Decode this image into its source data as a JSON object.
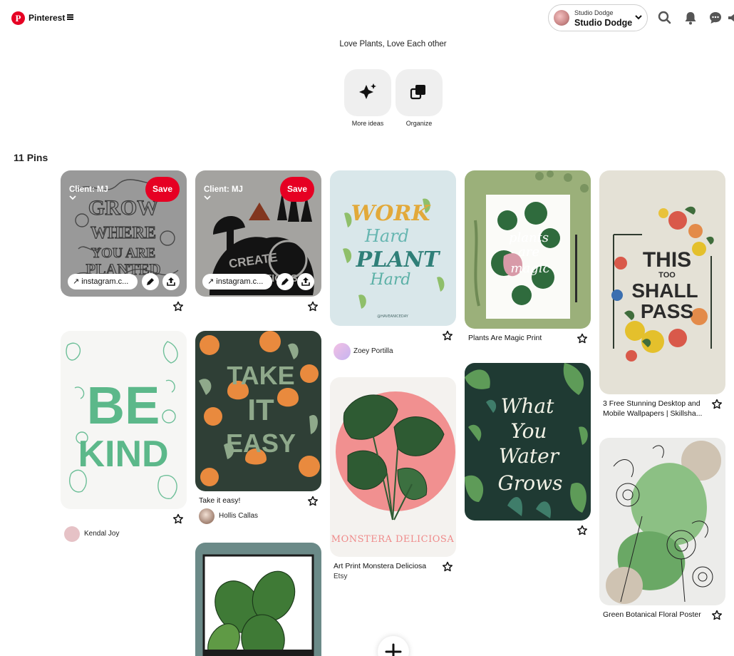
{
  "header": {
    "brand": "Pinterest",
    "account_small": "Studio Dodge",
    "account_name": "Studio Dodge"
  },
  "board": {
    "description": "Love Plants, Love Each other",
    "more_ideas_label": "More ideas",
    "organize_label": "Organize",
    "pin_count": "11 Pins"
  },
  "pins": {
    "grow": {
      "client": "Client: MJ",
      "save": "Save",
      "link": "instagram.c..."
    },
    "create": {
      "client": "Client: MJ",
      "save": "Save",
      "link": "instagram.c..."
    },
    "work": {
      "user": "Zoey Portilla"
    },
    "plants": {
      "title": "Plants Are Magic Print"
    },
    "this": {
      "title": "3 Free Stunning Desktop and Mobile Wallpapers | Skillsha..."
    },
    "bekind": {
      "user": "Kendal Joy"
    },
    "take": {
      "title": "Take it easy!",
      "user": "Hollis Callas"
    },
    "monstera": {
      "title": "Art Print Monstera Deliciosa",
      "source": "Etsy"
    },
    "green": {
      "title": "Green Botanical Floral Poster"
    }
  },
  "colors": {
    "brand_red": "#e60023",
    "tool_bg": "#efefef"
  }
}
